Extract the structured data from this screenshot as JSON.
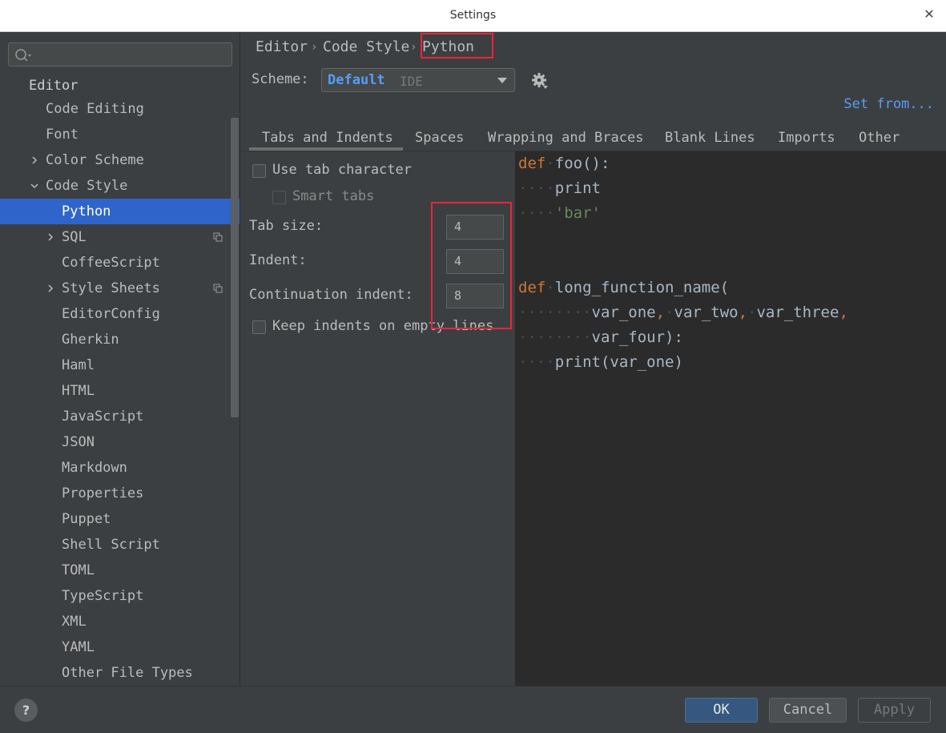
{
  "window": {
    "title": "Settings"
  },
  "sidebar": {
    "search_placeholder": "",
    "items": [
      {
        "label": "Editor"
      },
      {
        "label": "Code Editing"
      },
      {
        "label": "Font"
      },
      {
        "label": "Color Scheme"
      },
      {
        "label": "Code Style"
      },
      {
        "label": "Python"
      },
      {
        "label": "SQL"
      },
      {
        "label": "CoffeeScript"
      },
      {
        "label": "Style Sheets"
      },
      {
        "label": "EditorConfig"
      },
      {
        "label": "Gherkin"
      },
      {
        "label": "Haml"
      },
      {
        "label": "HTML"
      },
      {
        "label": "JavaScript"
      },
      {
        "label": "JSON"
      },
      {
        "label": "Markdown"
      },
      {
        "label": "Properties"
      },
      {
        "label": "Puppet"
      },
      {
        "label": "Shell Script"
      },
      {
        "label": "TOML"
      },
      {
        "label": "TypeScript"
      },
      {
        "label": "XML"
      },
      {
        "label": "YAML"
      },
      {
        "label": "Other File Types"
      }
    ],
    "selected": "Python"
  },
  "breadcrumb": [
    "Editor",
    "Code Style",
    "Python"
  ],
  "scheme": {
    "label": "Scheme:",
    "name": "Default",
    "kind": "IDE"
  },
  "set_from": "Set from...",
  "tabs": [
    "Tabs and Indents",
    "Spaces",
    "Wrapping and Braces",
    "Blank Lines",
    "Imports",
    "Other"
  ],
  "active_tab": "Tabs and Indents",
  "options": {
    "use_tab_character": {
      "label": "Use tab character",
      "checked": false
    },
    "smart_tabs": {
      "label": "Smart tabs",
      "checked": false,
      "enabled": false
    },
    "tab_size": {
      "label": "Tab size:",
      "value": "4"
    },
    "indent": {
      "label": "Indent:",
      "value": "4"
    },
    "continuation_indent": {
      "label": "Continuation indent:",
      "value": "8"
    },
    "keep_indents": {
      "label": "Keep indents on empty lines",
      "checked": false
    }
  },
  "preview": {
    "l1_kw": "def",
    "l1_rest": "foo():",
    "l2_ws": "····",
    "l2_rest": "print",
    "l3_ws": "····",
    "l3_str": "'bar'",
    "l6_kw": "def",
    "l6_rest": "long_function_name(",
    "l7_ws": "········",
    "l7_a": "var_one",
    "l7_b": "var_two",
    "l7_c": "var_three",
    "l8_ws": "········",
    "l8_rest": "var_four):",
    "l9_ws": "····",
    "l9_rest": "print(var_one)"
  },
  "footer": {
    "help": "?",
    "ok": "OK",
    "cancel": "Cancel",
    "apply": "Apply"
  },
  "colors": {
    "selection": "#2f65ca",
    "link": "#589df6",
    "keyword": "#cc7832",
    "string": "#6a8759",
    "highlight_box": "#e8263a"
  }
}
